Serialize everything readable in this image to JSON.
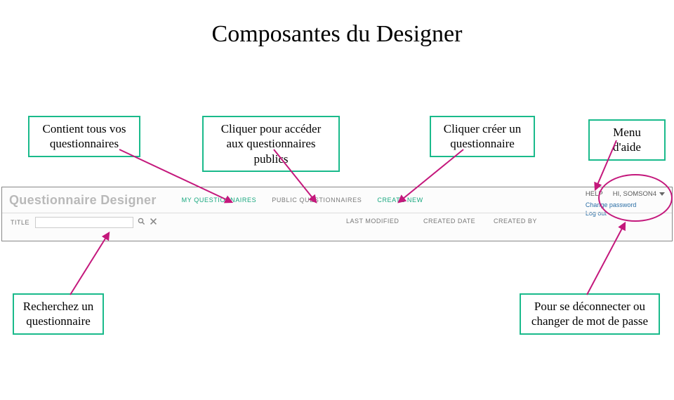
{
  "title": "Composantes du Designer",
  "callouts": {
    "contains": "Contient tous vos questionnaires",
    "public": "Cliquer pour accéder aux questionnaires publics",
    "create": "Cliquer créer un questionnaire",
    "help": "Menu d'aide",
    "search": "Recherchez un questionnaire",
    "logout": "Pour se déconnecter ou changer de mot de passe"
  },
  "app": {
    "title": "Questionnaire Designer",
    "nav": {
      "my": "MY QUESTIONNAIRES",
      "public": "PUBLIC QUESTIONNAIRES",
      "create": "CREATE NEW"
    },
    "right": {
      "help": "HELP",
      "greeting": "HI, SOMSON4",
      "change_pw": "Change password",
      "logout": "Log out"
    },
    "filter": {
      "title": "TITLE",
      "last_modified": "LAST MODIFIED",
      "created_date": "CREATED DATE",
      "created_by": "CREATED BY"
    }
  },
  "colors": {
    "accent_green": "#1aba8b",
    "magenta": "#c4187c"
  }
}
